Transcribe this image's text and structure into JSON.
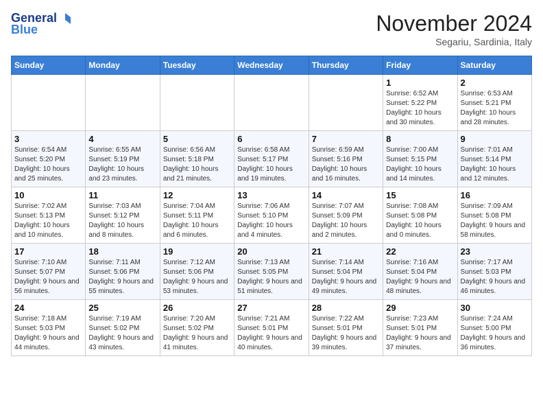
{
  "header": {
    "logo_general": "General",
    "logo_blue": "Blue",
    "month_title": "November 2024",
    "subtitle": "Segariu, Sardinia, Italy"
  },
  "weekdays": [
    "Sunday",
    "Monday",
    "Tuesday",
    "Wednesday",
    "Thursday",
    "Friday",
    "Saturday"
  ],
  "weeks": [
    [
      {
        "day": "",
        "info": ""
      },
      {
        "day": "",
        "info": ""
      },
      {
        "day": "",
        "info": ""
      },
      {
        "day": "",
        "info": ""
      },
      {
        "day": "",
        "info": ""
      },
      {
        "day": "1",
        "info": "Sunrise: 6:52 AM\nSunset: 5:22 PM\nDaylight: 10 hours and 30 minutes."
      },
      {
        "day": "2",
        "info": "Sunrise: 6:53 AM\nSunset: 5:21 PM\nDaylight: 10 hours and 28 minutes."
      }
    ],
    [
      {
        "day": "3",
        "info": "Sunrise: 6:54 AM\nSunset: 5:20 PM\nDaylight: 10 hours and 25 minutes."
      },
      {
        "day": "4",
        "info": "Sunrise: 6:55 AM\nSunset: 5:19 PM\nDaylight: 10 hours and 23 minutes."
      },
      {
        "day": "5",
        "info": "Sunrise: 6:56 AM\nSunset: 5:18 PM\nDaylight: 10 hours and 21 minutes."
      },
      {
        "day": "6",
        "info": "Sunrise: 6:58 AM\nSunset: 5:17 PM\nDaylight: 10 hours and 19 minutes."
      },
      {
        "day": "7",
        "info": "Sunrise: 6:59 AM\nSunset: 5:16 PM\nDaylight: 10 hours and 16 minutes."
      },
      {
        "day": "8",
        "info": "Sunrise: 7:00 AM\nSunset: 5:15 PM\nDaylight: 10 hours and 14 minutes."
      },
      {
        "day": "9",
        "info": "Sunrise: 7:01 AM\nSunset: 5:14 PM\nDaylight: 10 hours and 12 minutes."
      }
    ],
    [
      {
        "day": "10",
        "info": "Sunrise: 7:02 AM\nSunset: 5:13 PM\nDaylight: 10 hours and 10 minutes."
      },
      {
        "day": "11",
        "info": "Sunrise: 7:03 AM\nSunset: 5:12 PM\nDaylight: 10 hours and 8 minutes."
      },
      {
        "day": "12",
        "info": "Sunrise: 7:04 AM\nSunset: 5:11 PM\nDaylight: 10 hours and 6 minutes."
      },
      {
        "day": "13",
        "info": "Sunrise: 7:06 AM\nSunset: 5:10 PM\nDaylight: 10 hours and 4 minutes."
      },
      {
        "day": "14",
        "info": "Sunrise: 7:07 AM\nSunset: 5:09 PM\nDaylight: 10 hours and 2 minutes."
      },
      {
        "day": "15",
        "info": "Sunrise: 7:08 AM\nSunset: 5:08 PM\nDaylight: 10 hours and 0 minutes."
      },
      {
        "day": "16",
        "info": "Sunrise: 7:09 AM\nSunset: 5:08 PM\nDaylight: 9 hours and 58 minutes."
      }
    ],
    [
      {
        "day": "17",
        "info": "Sunrise: 7:10 AM\nSunset: 5:07 PM\nDaylight: 9 hours and 56 minutes."
      },
      {
        "day": "18",
        "info": "Sunrise: 7:11 AM\nSunset: 5:06 PM\nDaylight: 9 hours and 55 minutes."
      },
      {
        "day": "19",
        "info": "Sunrise: 7:12 AM\nSunset: 5:06 PM\nDaylight: 9 hours and 53 minutes."
      },
      {
        "day": "20",
        "info": "Sunrise: 7:13 AM\nSunset: 5:05 PM\nDaylight: 9 hours and 51 minutes."
      },
      {
        "day": "21",
        "info": "Sunrise: 7:14 AM\nSunset: 5:04 PM\nDaylight: 9 hours and 49 minutes."
      },
      {
        "day": "22",
        "info": "Sunrise: 7:16 AM\nSunset: 5:04 PM\nDaylight: 9 hours and 48 minutes."
      },
      {
        "day": "23",
        "info": "Sunrise: 7:17 AM\nSunset: 5:03 PM\nDaylight: 9 hours and 46 minutes."
      }
    ],
    [
      {
        "day": "24",
        "info": "Sunrise: 7:18 AM\nSunset: 5:03 PM\nDaylight: 9 hours and 44 minutes."
      },
      {
        "day": "25",
        "info": "Sunrise: 7:19 AM\nSunset: 5:02 PM\nDaylight: 9 hours and 43 minutes."
      },
      {
        "day": "26",
        "info": "Sunrise: 7:20 AM\nSunset: 5:02 PM\nDaylight: 9 hours and 41 minutes."
      },
      {
        "day": "27",
        "info": "Sunrise: 7:21 AM\nSunset: 5:01 PM\nDaylight: 9 hours and 40 minutes."
      },
      {
        "day": "28",
        "info": "Sunrise: 7:22 AM\nSunset: 5:01 PM\nDaylight: 9 hours and 39 minutes."
      },
      {
        "day": "29",
        "info": "Sunrise: 7:23 AM\nSunset: 5:01 PM\nDaylight: 9 hours and 37 minutes."
      },
      {
        "day": "30",
        "info": "Sunrise: 7:24 AM\nSunset: 5:00 PM\nDaylight: 9 hours and 36 minutes."
      }
    ]
  ]
}
